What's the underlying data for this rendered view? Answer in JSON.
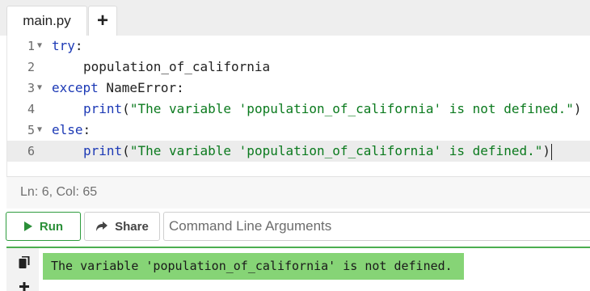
{
  "tabs": {
    "file_name": "main.py",
    "add_label": "+"
  },
  "editor": {
    "lines": [
      {
        "num": "1",
        "fold": true,
        "active": false
      },
      {
        "num": "2",
        "fold": false,
        "active": false
      },
      {
        "num": "3",
        "fold": true,
        "active": false
      },
      {
        "num": "4",
        "fold": false,
        "active": false
      },
      {
        "num": "5",
        "fold": true,
        "active": false
      },
      {
        "num": "6",
        "fold": false,
        "active": true
      }
    ],
    "code": {
      "l1_kw": "try",
      "l1_punct": ":",
      "l2_text": "population_of_california",
      "l3_kw": "except",
      "l3_rest": " NameError:",
      "l4_fn": "print",
      "l4_open": "(",
      "l4_str": "\"The variable 'population_of_california' is not defined.\"",
      "l4_close": ")",
      "l5_kw": "else",
      "l5_punct": ":",
      "l6_fn": "print",
      "l6_open": "(",
      "l6_str": "\"The variable 'population_of_california' is defined.\"",
      "l6_close": ")"
    }
  },
  "status": {
    "cursor_position": "Ln: 6,  Col: 65"
  },
  "actions": {
    "run_label": "Run",
    "share_label": "Share",
    "args_placeholder": "Command Line Arguments"
  },
  "output": {
    "text": "The variable 'population_of_california' is not defined."
  },
  "icons": {
    "run": "play-icon",
    "share": "share-arrow-icon",
    "copy": "copy-icon",
    "add": "plus-icon"
  },
  "colors": {
    "accent_green": "#2e9c3e",
    "output_bg": "#86d476",
    "keyword": "#1c39b5",
    "string": "#0b7a1e"
  }
}
